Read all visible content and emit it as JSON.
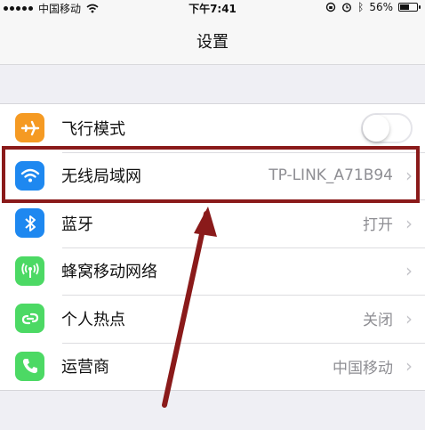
{
  "status_bar": {
    "carrier": "中国移动",
    "time": "下午7:41",
    "battery_text": "56%",
    "battery_level": 0.56
  },
  "nav": {
    "title": "设置"
  },
  "settings": [
    {
      "label": "飞行模式",
      "value": "",
      "icon": "airplane-icon",
      "color": "#f59a23",
      "control": "toggle",
      "toggle_on": false
    },
    {
      "label": "无线局域网",
      "value": "TP-LINK_A71B94",
      "icon": "wifi-icon",
      "color": "#1e88f0",
      "control": "chevron"
    },
    {
      "label": "蓝牙",
      "value": "打开",
      "icon": "bluetooth-icon",
      "color": "#1e88f0",
      "control": "chevron"
    },
    {
      "label": "蜂窝移动网络",
      "value": "",
      "icon": "cellular-icon",
      "color": "#4cd964",
      "control": "chevron"
    },
    {
      "label": "个人热点",
      "value": "关闭",
      "icon": "hotspot-icon",
      "color": "#4cd964",
      "control": "chevron"
    },
    {
      "label": "运营商",
      "value": "中国移动",
      "icon": "phone-icon",
      "color": "#4cd964",
      "control": "chevron"
    }
  ],
  "annotation_color": "#8a1a1a"
}
